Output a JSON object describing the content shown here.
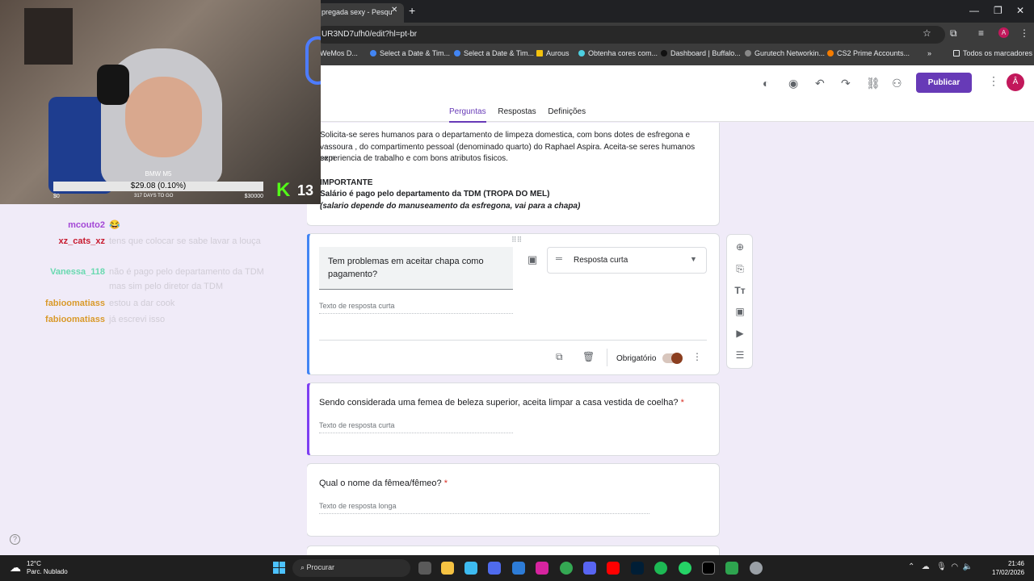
{
  "browser": {
    "tab_title": "pregada sexy - Pesqu",
    "url": "UR3ND7ufh0/edit?hl=pt-br",
    "bookmarks": [
      "WeMos D...",
      "Select a Date & Tim...",
      "Select a Date & Tim...",
      "Aurous",
      "Obtenha cores com...",
      "Dashboard | Buffalo...",
      "Gurutech Networkin...",
      "CS2 Prime Accounts..."
    ],
    "all_bookmarks": "Todos os marcadores"
  },
  "forms": {
    "publish_label": "Publicar",
    "avatar_letter": "Â",
    "tabs": [
      "Perguntas",
      "Respostas",
      "Definições"
    ],
    "description": {
      "line1": "Solicita-se seres humanos para o departamento de limpeza domestica, com bons dotes de esfregona e",
      "line2": "vassoura , do compartimento pessoal (denominado quarto) do Raphael Aspira. Aceita-se seres humanos sem",
      "line3": "experiencia de trabalho e com bons atributos fisicos.",
      "important": "IMPORTANTE",
      "salary": "Salário é pago pelo departamento da TDM (TROPA DO MEL)",
      "salary_note": "(salario depende do manuseamento da esfregona, vai para a chapa)"
    },
    "q1": {
      "title": "Tem problemas em aceitar chapa como pagamento?",
      "type": "Resposta curta",
      "hint": "Texto de resposta curta",
      "required_label": "Obrigatório"
    },
    "q2": {
      "title": "Sendo considerada uma femea de beleza superior, aceita limpar a casa vestida de coelha?",
      "required_mark": "*",
      "hint": "Texto de resposta curta"
    },
    "q3": {
      "title": "Qual o nome da fêmea/fêmeo?",
      "required_mark": "*",
      "hint": "Texto de resposta longa"
    }
  },
  "stream": {
    "ticker_label": "BMW M5",
    "ticker_value": "$29.08 (0.10%)",
    "ticker_min": "$0",
    "ticker_days": "317 DAYS TO GO",
    "ticker_max": "$30000",
    "viewer_count": "13"
  },
  "chat": [
    {
      "user": "mcouto2",
      "color": "#a347d6",
      "msg": "😂"
    },
    {
      "user": "xz_cats_xz",
      "color": "#c71a2e",
      "msg": "tens que colocar se sabe lavar a louça"
    },
    {
      "user": "Vanessa_118",
      "color": "#69d9b0",
      "msg": "não é pago pelo departamento da TDM mas sim pelo diretor da TDM"
    },
    {
      "user": "fabioomatiass",
      "color": "#d99a2b",
      "msg": "estou a dar cook"
    },
    {
      "user": "fabioomatiass",
      "color": "#d99a2b",
      "msg": "já escrevi isso"
    }
  ],
  "taskbar": {
    "temp": "12°C",
    "weather": "Parc. Nublado",
    "search": "Procurar",
    "time": "21:46",
    "date": "17/02/2026"
  }
}
